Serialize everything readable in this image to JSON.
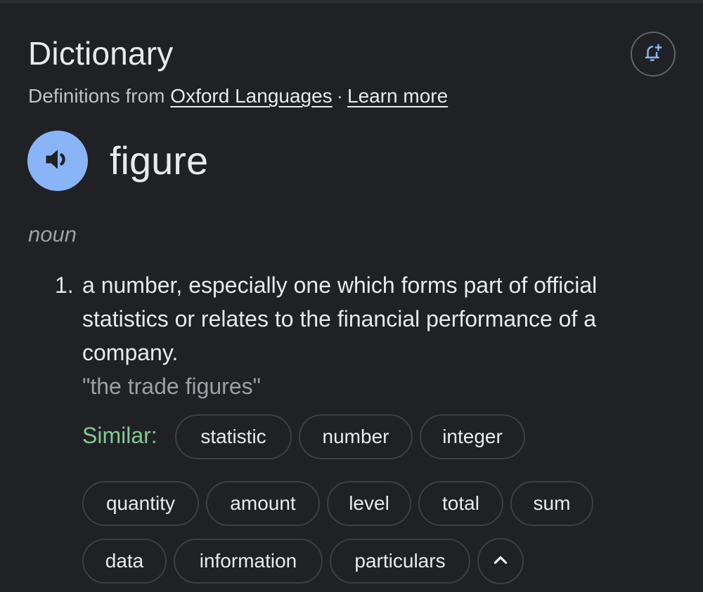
{
  "header": {
    "title": "Dictionary",
    "source_prefix": "Definitions from",
    "source_link": "Oxford Languages",
    "separator": "·",
    "learn_more": "Learn more",
    "alert_icon": "bell-plus-icon"
  },
  "entry": {
    "word": "figure",
    "speaker_icon": "speaker-icon",
    "part_of_speech": "noun",
    "definitions": [
      {
        "number": "1.",
        "text": "a number, especially one which forms part of official statistics or relates to the financial performance of a company.",
        "example": "\"the trade figures\""
      }
    ]
  },
  "similar": {
    "label": "Similar:",
    "row1": [
      "statistic",
      "number",
      "integer"
    ],
    "row2": [
      "quantity",
      "amount",
      "level",
      "total",
      "sum"
    ],
    "row3": [
      "data",
      "information",
      "particulars"
    ],
    "collapse_icon": "chevron-up-icon"
  },
  "colors": {
    "background": "#202124",
    "accent_blue": "#8ab4f8",
    "similar_green": "#81c995",
    "chip_border": "#3c4043"
  }
}
